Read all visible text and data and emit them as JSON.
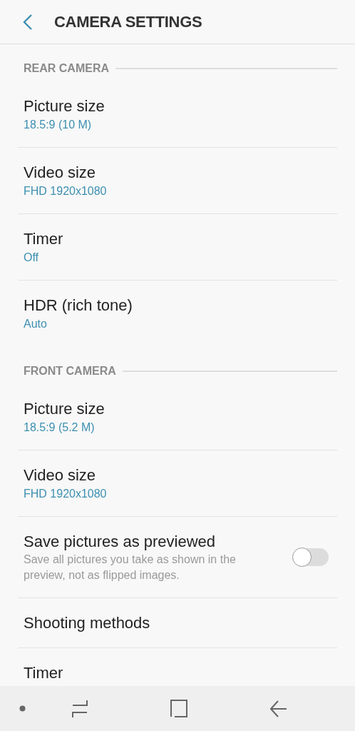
{
  "header": {
    "title": "CAMERA SETTINGS"
  },
  "sections": [
    {
      "title": "REAR CAMERA",
      "items": [
        {
          "kind": "value",
          "title": "Picture size",
          "value": "18.5:9 (10 M)"
        },
        {
          "kind": "value",
          "title": "Video size",
          "value": "FHD 1920x1080"
        },
        {
          "kind": "value",
          "title": "Timer",
          "value": "Off"
        },
        {
          "kind": "value",
          "title": "HDR (rich tone)",
          "value": "Auto"
        }
      ]
    },
    {
      "title": "FRONT CAMERA",
      "items": [
        {
          "kind": "value",
          "title": "Picture size",
          "value": "18.5:9 (5.2 M)"
        },
        {
          "kind": "value",
          "title": "Video size",
          "value": "FHD 1920x1080"
        },
        {
          "kind": "switch",
          "title": "Save pictures as previewed",
          "description": "Save all pictures you take as shown in the preview, not as flipped images.",
          "on": false
        },
        {
          "kind": "plain",
          "title": "Shooting methods"
        },
        {
          "kind": "plain",
          "title": "Timer"
        }
      ]
    }
  ]
}
